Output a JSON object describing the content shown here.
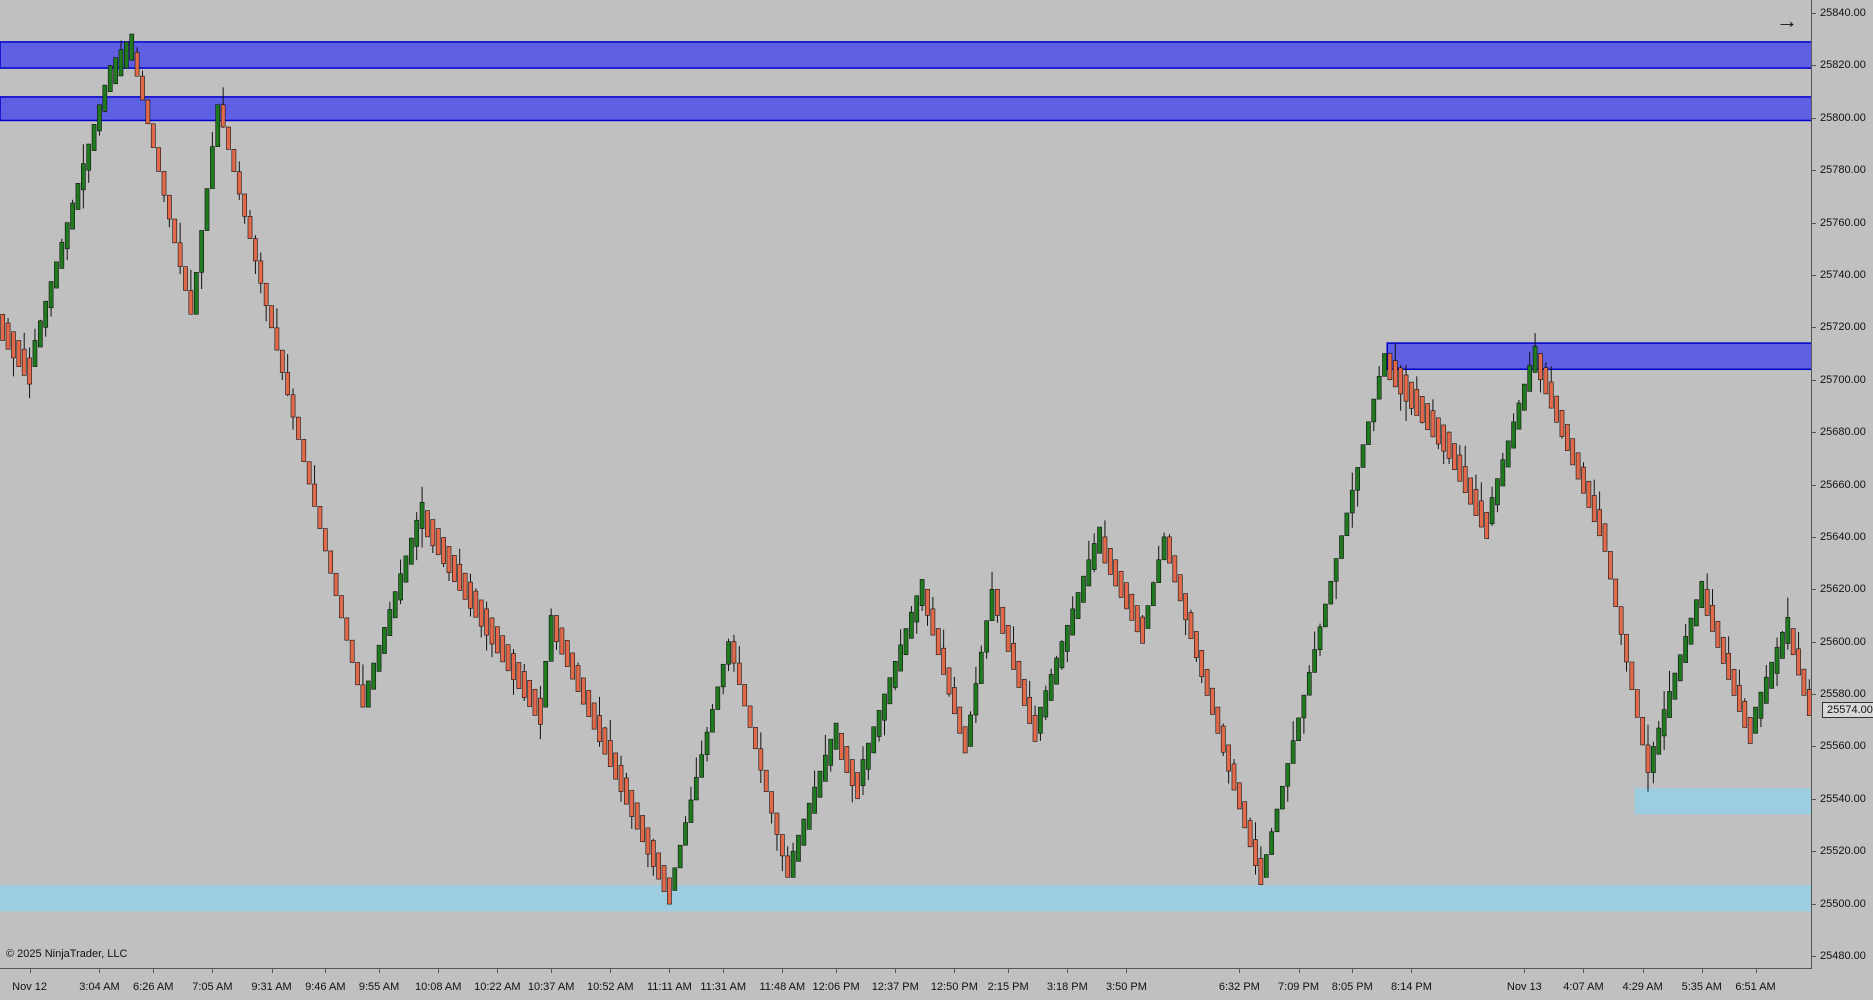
{
  "app": {
    "copyright": "© 2025 NinjaTrader, LLC",
    "current_price": "25574.00",
    "arrow_icon": "arrow-right-icon"
  },
  "colors": {
    "background": "#c0c0c0",
    "up_candle": "#1f7a1f",
    "down_candle": "#e26a4a",
    "resistance_zone": "#5a5ae6",
    "support_zone": "#9acde3"
  },
  "chart_data": {
    "type": "candlestick",
    "ylim": [
      25475,
      25845
    ],
    "y_ticks": [
      "25840.00",
      "25820.00",
      "25800.00",
      "25780.00",
      "25760.00",
      "25740.00",
      "25720.00",
      "25700.00",
      "25680.00",
      "25660.00",
      "25640.00",
      "25620.00",
      "25600.00",
      "25580.00",
      "25560.00",
      "25540.00",
      "25520.00",
      "25500.00",
      "25480.00"
    ],
    "x_labels": [
      {
        "label": "Nov 12",
        "bar": 5
      },
      {
        "label": "3:04 AM",
        "bar": 18
      },
      {
        "label": "6:26 AM",
        "bar": 28
      },
      {
        "label": "7:05 AM",
        "bar": 39
      },
      {
        "label": "9:31 AM",
        "bar": 50
      },
      {
        "label": "9:46 AM",
        "bar": 60
      },
      {
        "label": "9:55 AM",
        "bar": 70
      },
      {
        "label": "10:08 AM",
        "bar": 81
      },
      {
        "label": "10:22 AM",
        "bar": 92
      },
      {
        "label": "10:37 AM",
        "bar": 102
      },
      {
        "label": "10:52 AM",
        "bar": 113
      },
      {
        "label": "11:11 AM",
        "bar": 124
      },
      {
        "label": "11:31 AM",
        "bar": 134
      },
      {
        "label": "11:48 AM",
        "bar": 145
      },
      {
        "label": "12:06 PM",
        "bar": 155
      },
      {
        "label": "12:37 PM",
        "bar": 166
      },
      {
        "label": "12:50 PM",
        "bar": 177
      },
      {
        "label": "2:15 PM",
        "bar": 187
      },
      {
        "label": "3:18 PM",
        "bar": 198
      },
      {
        "label": "3:50 PM",
        "bar": 209
      },
      {
        "label": "6:32 PM",
        "bar": 230
      },
      {
        "label": "7:09 PM",
        "bar": 241
      },
      {
        "label": "8:05 PM",
        "bar": 251
      },
      {
        "label": "8:14 PM",
        "bar": 262
      },
      {
        "label": "Nov 13",
        "bar": 283
      },
      {
        "label": "4:07 AM",
        "bar": 294
      },
      {
        "label": "4:29 AM",
        "bar": 305
      },
      {
        "label": "5:35 AM",
        "bar": 316
      },
      {
        "label": "6:51 AM",
        "bar": 326
      }
    ],
    "bar_count": 337,
    "brick_size": 10,
    "waypoints": [
      [
        0,
        25725
      ],
      [
        6,
        25705
      ],
      [
        20,
        25810
      ],
      [
        25,
        25825
      ],
      [
        36,
        25725
      ],
      [
        41,
        25805
      ],
      [
        68,
        25575
      ],
      [
        79,
        25650
      ],
      [
        101,
        25575
      ],
      [
        103,
        25610
      ],
      [
        125,
        25505
      ],
      [
        136,
        25600
      ],
      [
        147,
        25510
      ],
      [
        156,
        25565
      ],
      [
        160,
        25545
      ],
      [
        172,
        25620
      ],
      [
        180,
        25560
      ],
      [
        185,
        25620
      ],
      [
        193,
        25565
      ],
      [
        205,
        25640
      ],
      [
        213,
        25605
      ],
      [
        217,
        25640
      ],
      [
        235,
        25510
      ],
      [
        258,
        25710
      ],
      [
        269,
        25680
      ],
      [
        277,
        25645
      ],
      [
        286,
        25710
      ],
      [
        298,
        25645
      ],
      [
        307,
        25550
      ],
      [
        317,
        25620
      ],
      [
        326,
        25565
      ],
      [
        333,
        25605
      ],
      [
        337,
        25574
      ]
    ],
    "zones": [
      {
        "kind": "resistance",
        "low": 25819,
        "high": 25829,
        "from_bar": 0,
        "to_bar": 337
      },
      {
        "kind": "resistance",
        "low": 25799,
        "high": 25808,
        "from_bar": 0,
        "to_bar": 337
      },
      {
        "kind": "resistance",
        "low": 25704,
        "high": 25714,
        "from_bar": 258,
        "to_bar": 337
      },
      {
        "kind": "support",
        "low": 25534,
        "high": 25544,
        "from_bar": 304,
        "to_bar": 337
      },
      {
        "kind": "support",
        "low": 25497,
        "high": 25507,
        "from_bar": 0,
        "to_bar": 337
      }
    ]
  }
}
